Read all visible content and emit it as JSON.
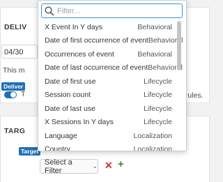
{
  "background": {
    "delivery_title": "DELIV",
    "date_value": "04/30",
    "message_fragment": "This m",
    "delivery_tag": "Deliver",
    "toggle_label": "T",
    "rules_fragment": "ing rules.",
    "target_title": "TARG",
    "target_tag": "Target"
  },
  "filter_row": {
    "select_label": "Select a Filter",
    "remove_symbol": "✕",
    "add_symbol": "+"
  },
  "dropdown": {
    "search_placeholder": "Filter...",
    "options": [
      {
        "label": "X Event In Y days",
        "category": "Behavioral"
      },
      {
        "label": "Date of first occurrence of event",
        "category": "Behavioral"
      },
      {
        "label": "Occurrences of event",
        "category": "Behavioral"
      },
      {
        "label": "Date of last occurrence of event",
        "category": "Behavioral"
      },
      {
        "label": "Date of first use",
        "category": "Lifecycle"
      },
      {
        "label": "Session count",
        "category": "Lifecycle"
      },
      {
        "label": "Date of last use",
        "category": "Lifecycle"
      },
      {
        "label": "X Sessions In Y days",
        "category": "Lifecycle"
      },
      {
        "label": "Language",
        "category": "Localization"
      },
      {
        "label": "Country",
        "category": "Localization"
      }
    ]
  },
  "colors": {
    "accent_blue": "#1f6fb5",
    "focus_blue": "#3d8fd6",
    "remove_red": "#d0342c",
    "add_green": "#2e8b3e"
  },
  "icons": {
    "search": "search-icon",
    "chevron": "chevron-down-icon",
    "remove": "close-icon",
    "add": "plus-icon"
  }
}
